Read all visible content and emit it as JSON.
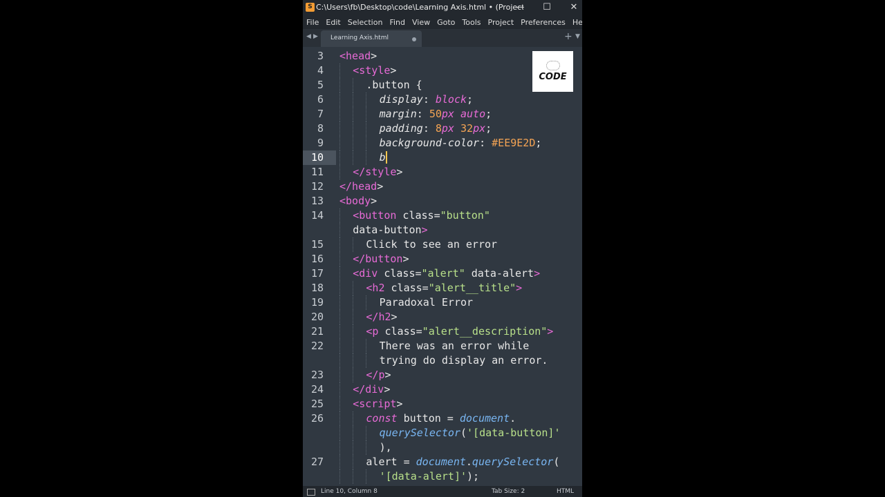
{
  "window": {
    "title": "C:\\Users\\fb\\Desktop\\code\\Learning Axis.html • (Project) - Su...",
    "minimize": "—",
    "maximize": "☐",
    "close": "✕"
  },
  "menu": [
    "File",
    "Edit",
    "Selection",
    "Find",
    "View",
    "Goto",
    "Tools",
    "Project",
    "Preferences",
    "Help"
  ],
  "tabs": {
    "back": "◀",
    "forward": "▶",
    "active_label": "Learning Axis.html",
    "new_tab": "+",
    "tab_menu": "▼"
  },
  "logo": {
    "text": "CODE"
  },
  "editor": {
    "current_line": 10,
    "lines": [
      {
        "n": "3",
        "tokens": [
          [
            "tag",
            "<head"
          ],
          [
            "pun",
            ">"
          ]
        ]
      },
      {
        "n": "4",
        "tokens": [
          [
            "tag",
            "<style"
          ],
          [
            "pun",
            ">"
          ]
        ]
      },
      {
        "n": "5",
        "tokens": [
          [
            "pun",
            ".button {"
          ]
        ]
      },
      {
        "n": "6",
        "tokens": [
          [
            "prop",
            "display"
          ],
          [
            "pun",
            ": "
          ],
          [
            "val",
            "block"
          ],
          [
            "pun",
            ";"
          ]
        ]
      },
      {
        "n": "7",
        "tokens": [
          [
            "prop",
            "margin"
          ],
          [
            "pun",
            ": "
          ],
          [
            "num",
            "50"
          ],
          [
            "val",
            "px"
          ],
          [
            "pun",
            " "
          ],
          [
            "val",
            "auto"
          ],
          [
            "pun",
            ";"
          ]
        ]
      },
      {
        "n": "8",
        "tokens": [
          [
            "prop",
            "padding"
          ],
          [
            "pun",
            ": "
          ],
          [
            "num",
            "8"
          ],
          [
            "val",
            "px"
          ],
          [
            "pun",
            " "
          ],
          [
            "num",
            "32"
          ],
          [
            "val",
            "px"
          ],
          [
            "pun",
            ";"
          ]
        ]
      },
      {
        "n": "9",
        "tokens": [
          [
            "prop",
            "background-color"
          ],
          [
            "pun",
            ": "
          ],
          [
            "num",
            "#EE9E2D"
          ],
          [
            "pun",
            ";"
          ]
        ]
      },
      {
        "n": "10",
        "tokens": [
          [
            "prop",
            "b"
          ]
        ]
      },
      {
        "n": "11",
        "tokens": [
          [
            "tag",
            "</style"
          ],
          [
            "pun",
            ">"
          ]
        ]
      },
      {
        "n": "12",
        "tokens": [
          [
            "tag",
            "</head"
          ],
          [
            "pun",
            ">"
          ]
        ]
      },
      {
        "n": "13",
        "tokens": [
          [
            "tag",
            "<body"
          ],
          [
            "pun",
            ">"
          ]
        ]
      },
      {
        "n": "14",
        "tokens": [
          [
            "tag",
            "<button"
          ],
          [
            "pun",
            " class="
          ],
          [
            "str",
            "\"button\""
          ]
        ]
      },
      {
        "n": "",
        "tokens": [
          [
            "pun",
            "data-button"
          ],
          [
            "tag",
            ">"
          ]
        ]
      },
      {
        "n": "15",
        "tokens": [
          [
            "pun",
            "Click to see an error"
          ]
        ]
      },
      {
        "n": "16",
        "tokens": [
          [
            "tag",
            "</button"
          ],
          [
            "pun",
            ">"
          ]
        ]
      },
      {
        "n": "17",
        "tokens": [
          [
            "tag",
            "<div"
          ],
          [
            "pun",
            " class="
          ],
          [
            "str",
            "\"alert\""
          ],
          [
            "pun",
            " data-alert"
          ],
          [
            "tag",
            ">"
          ]
        ]
      },
      {
        "n": "18",
        "tokens": [
          [
            "tag",
            "<h2"
          ],
          [
            "pun",
            " class="
          ],
          [
            "str",
            "\"alert__title\""
          ],
          [
            "tag",
            ">"
          ]
        ]
      },
      {
        "n": "19",
        "tokens": [
          [
            "pun",
            "Paradoxal Error"
          ]
        ]
      },
      {
        "n": "20",
        "tokens": [
          [
            "tag",
            "</h2"
          ],
          [
            "pun",
            ">"
          ]
        ]
      },
      {
        "n": "21",
        "tokens": [
          [
            "tag",
            "<p"
          ],
          [
            "pun",
            " class="
          ],
          [
            "str",
            "\"alert__description\""
          ],
          [
            "tag",
            ">"
          ]
        ]
      },
      {
        "n": "22",
        "tokens": [
          [
            "pun",
            "There was an error while"
          ]
        ]
      },
      {
        "n": "",
        "tokens": [
          [
            "pun",
            "trying do display an error."
          ]
        ]
      },
      {
        "n": "23",
        "tokens": [
          [
            "tag",
            "</p"
          ],
          [
            "pun",
            ">"
          ]
        ]
      },
      {
        "n": "24",
        "tokens": [
          [
            "tag",
            "</div"
          ],
          [
            "pun",
            ">"
          ]
        ]
      },
      {
        "n": "25",
        "tokens": [
          [
            "tag",
            "<script"
          ],
          [
            "pun",
            ">"
          ]
        ]
      },
      {
        "n": "26",
        "tokens": [
          [
            "kw",
            "const"
          ],
          [
            "pun",
            " button = "
          ],
          [
            "obj",
            "document"
          ],
          [
            "pun",
            "."
          ]
        ]
      },
      {
        "n": "",
        "tokens": [
          [
            "obj",
            "querySelector"
          ],
          [
            "pun",
            "("
          ],
          [
            "str",
            "'[data-button]'"
          ]
        ]
      },
      {
        "n": "",
        "tokens": [
          [
            "pun",
            "),"
          ]
        ]
      },
      {
        "n": "27",
        "tokens": [
          [
            "pun",
            "alert = "
          ],
          [
            "obj",
            "document"
          ],
          [
            "pun",
            "."
          ],
          [
            "obj",
            "querySelector"
          ],
          [
            "pun",
            "("
          ]
        ]
      },
      {
        "n": "",
        "tokens": [
          [
            "str",
            "'[data-alert]'"
          ],
          [
            "pun",
            ");"
          ]
        ]
      }
    ]
  },
  "status": {
    "position": "Line 10, Column 8",
    "tab_size": "Tab Size: 2",
    "syntax": "HTML"
  }
}
